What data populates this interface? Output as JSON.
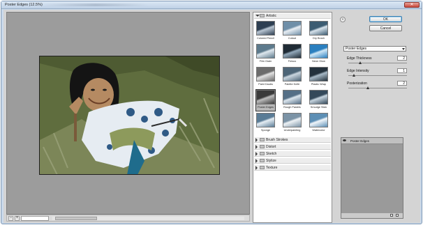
{
  "window": {
    "title": "Poster Edges (12.5%)",
    "close_glyph": "✕"
  },
  "preview": {
    "zoom_minus": "−",
    "zoom_plus": "+",
    "zoom_level": ""
  },
  "gallery": {
    "categories": [
      {
        "label": "Artistic",
        "expanded": true
      },
      {
        "label": "Brush Strokes",
        "expanded": false
      },
      {
        "label": "Distort",
        "expanded": false
      },
      {
        "label": "Sketch",
        "expanded": false
      },
      {
        "label": "Stylize",
        "expanded": false
      },
      {
        "label": "Texture",
        "expanded": false
      }
    ],
    "thumbs": [
      {
        "name": "Colored Pencil"
      },
      {
        "name": "Cutout"
      },
      {
        "name": "Dry Brush"
      },
      {
        "name": "Film Grain"
      },
      {
        "name": "Fresco"
      },
      {
        "name": "Neon Glow"
      },
      {
        "name": "Paint Daubs"
      },
      {
        "name": "Palette Knife"
      },
      {
        "name": "Plastic Wrap"
      },
      {
        "name": "Poster Edges"
      },
      {
        "name": "Rough Pastels"
      },
      {
        "name": "Smudge Stick"
      },
      {
        "name": "Sponge"
      },
      {
        "name": "Underpainting"
      },
      {
        "name": "Watercolor"
      }
    ],
    "selected": "Poster Edges"
  },
  "controls": {
    "ok_label": "OK",
    "cancel_label": "Cancel",
    "collapse_glyph": "«",
    "filter_select": "Poster Edges",
    "params": [
      {
        "label": "Edge Thickness",
        "value": "2",
        "level": 0.2
      },
      {
        "label": "Edge Intensity",
        "value": "1",
        "level": 0.1
      },
      {
        "label": "Posterization",
        "value": "2",
        "level": 0.33
      }
    ]
  },
  "layers": {
    "items": [
      {
        "name": "Poster Edges"
      }
    ]
  },
  "colors": {
    "accent": "#3c7fb1",
    "photo_grass": "#5f6d3e",
    "kimono_blue": "#2f6f9c"
  }
}
